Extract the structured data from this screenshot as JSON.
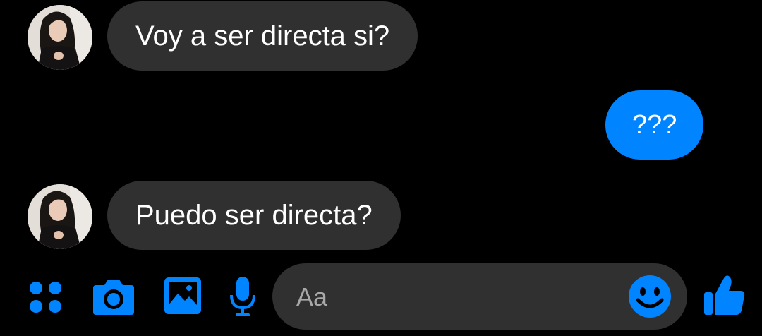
{
  "colors": {
    "background": "#000000",
    "incoming_bubble": "#303030",
    "outgoing_bubble": "#0084ff",
    "accent": "#0084ff",
    "text": "#ffffff",
    "placeholder": "#a8a8a8"
  },
  "messages": [
    {
      "sender": "contact",
      "text": "Voy a ser directa si?",
      "has_avatar": true
    },
    {
      "sender": "me",
      "text": "???",
      "has_avatar": false
    },
    {
      "sender": "contact",
      "text": "Puedo ser directa?",
      "has_avatar": true
    }
  ],
  "composer": {
    "placeholder": "Aa",
    "icons": [
      "menu-dots-icon",
      "camera-icon",
      "gallery-icon",
      "microphone-icon",
      "emoji-icon",
      "thumbs-up-icon"
    ]
  }
}
